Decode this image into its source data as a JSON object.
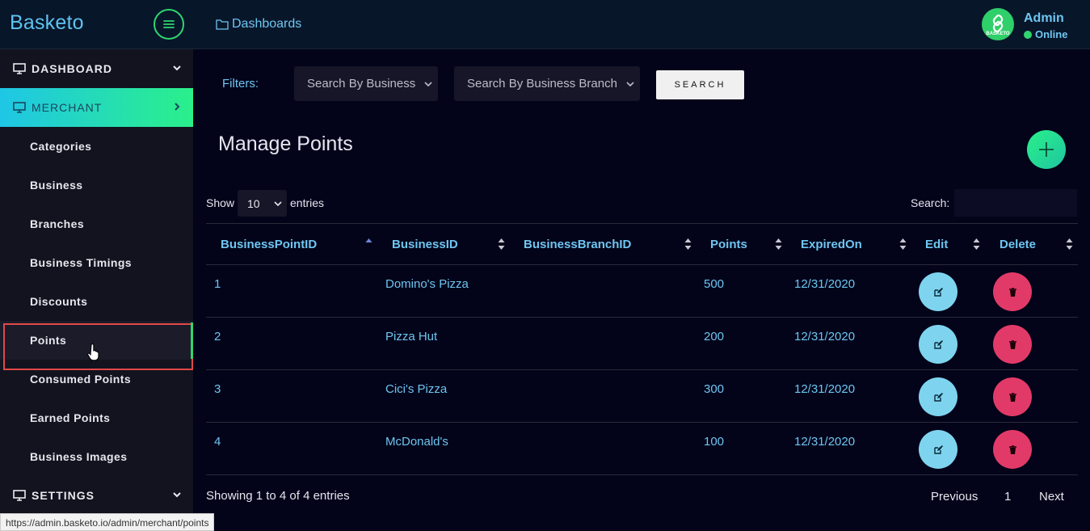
{
  "header": {
    "brand": "Basketo",
    "breadcrumb": "Dashboards",
    "user_name": "Admin",
    "user_status": "Online",
    "avatar_text": "BASKETO",
    "colors": {
      "accent": "#6ec6f0",
      "online": "#2fd66f"
    }
  },
  "sidebar": {
    "sections": [
      {
        "label": "DASHBOARD",
        "icon": "monitor-icon",
        "chevron": "chevron-down-icon"
      },
      {
        "label": "MERCHANT",
        "icon": "monitor-icon",
        "chevron": "chevron-right-icon",
        "active": true
      },
      {
        "label": "SETTINGS",
        "icon": "monitor-icon",
        "chevron": "chevron-down-icon"
      }
    ],
    "items": [
      {
        "label": "Categories"
      },
      {
        "label": "Business"
      },
      {
        "label": "Branches"
      },
      {
        "label": "Business Timings"
      },
      {
        "label": "Discounts"
      },
      {
        "label": "Points",
        "active": true
      },
      {
        "label": "Consumed Points"
      },
      {
        "label": "Earned Points"
      },
      {
        "label": "Business Images"
      }
    ]
  },
  "status_bar": {
    "url": "https://admin.basketo.io/admin/merchant/points"
  },
  "filters": {
    "label": "Filters:",
    "business_select": "Search By Business",
    "branch_select": "Search By Business Branch",
    "search_button": "SEARCH"
  },
  "page": {
    "title": "Manage Points",
    "add_icon": "plus-icon"
  },
  "table_controls": {
    "show_label": "Show",
    "entries_value": "10",
    "entries_label": "entries",
    "search_label": "Search:"
  },
  "table": {
    "columns": [
      "BusinessPointID",
      "BusinessID",
      "BusinessBranchID",
      "Points",
      "ExpiredOn",
      "Edit",
      "Delete"
    ],
    "rows": [
      {
        "id": "1",
        "business": "Domino's Pizza",
        "branch": "",
        "points": "500",
        "expired": "12/31/2020"
      },
      {
        "id": "2",
        "business": "Pizza Hut",
        "branch": "",
        "points": "200",
        "expired": "12/31/2020"
      },
      {
        "id": "3",
        "business": "Cici's Pizza",
        "branch": "",
        "points": "300",
        "expired": "12/31/2020"
      },
      {
        "id": "4",
        "business": "McDonald's",
        "branch": "",
        "points": "100",
        "expired": "12/31/2020"
      }
    ]
  },
  "footer": {
    "info": "Showing 1 to 4 of 4 entries",
    "previous": "Previous",
    "page": "1",
    "next": "Next"
  }
}
